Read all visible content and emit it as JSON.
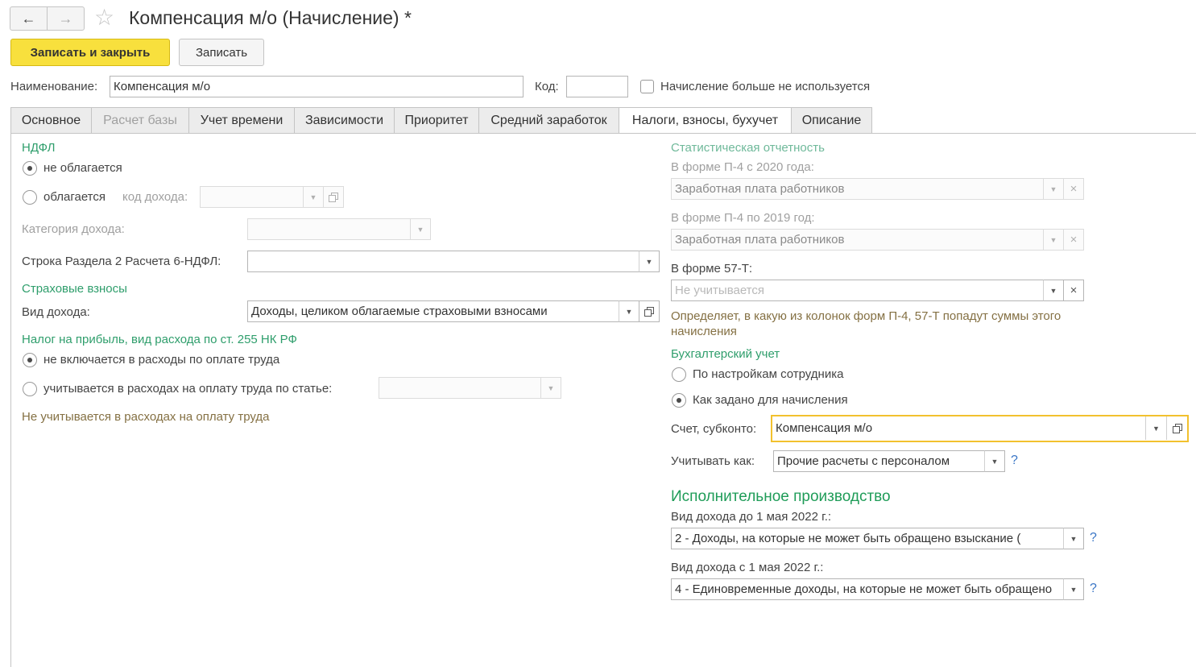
{
  "header": {
    "back_icon": "arrow-left-icon",
    "forward_icon": "arrow-right-icon",
    "favorite_icon": "star-icon",
    "title": "Компенсация м/о (Начисление) *"
  },
  "toolbar": {
    "save_close_label": "Записать и закрыть",
    "save_label": "Записать"
  },
  "form": {
    "name_label": "Наименование:",
    "name_value": "Компенсация м/о",
    "code_label": "Код:",
    "code_value": "",
    "unused_label": "Начисление больше не используется"
  },
  "tabs": [
    {
      "label": "Основное"
    },
    {
      "label": "Расчет базы"
    },
    {
      "label": "Учет времени"
    },
    {
      "label": "Зависимости"
    },
    {
      "label": "Приоритет"
    },
    {
      "label": "Средний заработок"
    },
    {
      "label": "Налоги, взносы, бухучет"
    },
    {
      "label": "Описание"
    }
  ],
  "left": {
    "ndfl_title": "НДФЛ",
    "not_taxed": "не облагается",
    "taxed": "облагается",
    "income_code_label": "код дохода:",
    "income_code_value": "",
    "income_category_label": "Категория дохода:",
    "income_category_value": "",
    "row6ndfl_label": "Строка Раздела 2 Расчета 6-НДФЛ:",
    "row6ndfl_value": "",
    "insurance_title": "Страховые взносы",
    "income_type_label": "Вид дохода:",
    "income_type_value": "Доходы, целиком облагаемые страховыми взносами",
    "profit_tax_title": "Налог на прибыль, вид расхода по ст. 255 НК РФ",
    "not_included": "не включается в расходы по оплате труда",
    "included_by_article": "учитывается в расходах на оплату труда по статье:",
    "article_value": "",
    "not_accounted_note": "Не учитывается в расходах на оплату труда"
  },
  "right": {
    "stat_title": "Статистическая отчетность",
    "p4_2020_label": "В форме П-4 с 2020 года:",
    "p4_2020_value": "Заработная плата работников",
    "p4_2019_label": "В форме П-4 по 2019 год:",
    "p4_2019_value": "Заработная плата работников",
    "f57t_label": "В форме 57-Т:",
    "f57t_placeholder": "Не учитывается",
    "stat_note": "Определяет, в какую из колонок форм П-4, 57-Т попадут суммы этого начисления",
    "accounting_title": "Бухгалтерский учет",
    "by_employee": "По настройкам сотрудника",
    "as_set": "Как задано для начисления",
    "account_label": "Счет, субконто:",
    "account_value": "Компенсация м/о",
    "treat_as_label": "Учитывать как:",
    "treat_as_value": "Прочие расчеты с персоналом",
    "help_mark": "?",
    "enforcement_title": "Исполнительное производство",
    "before_label": "Вид дохода до 1 мая 2022 г.:",
    "before_value": "2 - Доходы, на которые не может быть обращено взыскание (",
    "after_label": "Вид дохода с 1 мая 2022 г.:",
    "after_value": "4 - Единовременные доходы, на которые не может быть обращено"
  }
}
